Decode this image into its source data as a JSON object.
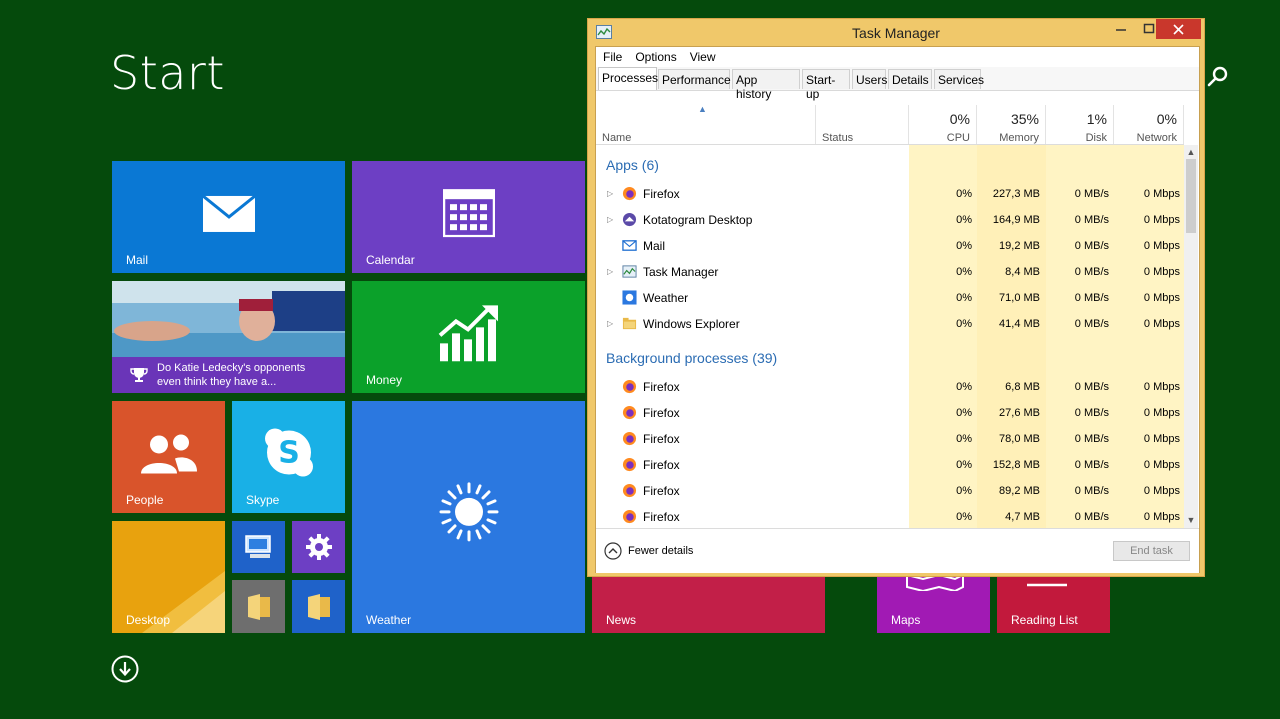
{
  "start": {
    "title": "Start"
  },
  "tiles": {
    "mail": "Mail",
    "calendar": "Calendar",
    "news_headline": "Do Katie Ledecky's opponents even think they have a...",
    "money": "Money",
    "people": "People",
    "skype": "Skype",
    "weather": "Weather",
    "desktop": "Desktop",
    "news": "News",
    "maps": "Maps",
    "reading_list": "Reading List"
  },
  "colors": {
    "background": "#054a0c",
    "mail": "#0a78d4",
    "calendar": "#6d3fc4",
    "money": "#0ba12a",
    "people": "#d9542b",
    "skype": "#19b0e6",
    "weather": "#2b78e0",
    "desktop": "#e8a20e",
    "news": "#c21f48",
    "maps": "#a11ab4",
    "reading_list": "#c2193c"
  },
  "task_manager": {
    "title": "Task Manager",
    "menu": [
      "File",
      "Options",
      "View"
    ],
    "tabs": [
      "Processes",
      "Performance",
      "App history",
      "Start-up",
      "Users",
      "Details",
      "Services"
    ],
    "active_tab": "Processes",
    "columns": {
      "name": "Name",
      "status": "Status",
      "cpu": {
        "pct": "0%",
        "label": "CPU"
      },
      "memory": {
        "pct": "35%",
        "label": "Memory"
      },
      "disk": {
        "pct": "1%",
        "label": "Disk"
      },
      "network": {
        "pct": "0%",
        "label": "Network"
      }
    },
    "apps_header": "Apps (6)",
    "apps": [
      {
        "name": "Firefox",
        "icon": "firefox-icon",
        "expand": true,
        "cpu": "0%",
        "memory": "227,3 MB",
        "disk": "0 MB/s",
        "network": "0 Mbps"
      },
      {
        "name": "Kotatogram Desktop",
        "icon": "kotatogram-icon",
        "expand": true,
        "cpu": "0%",
        "memory": "164,9 MB",
        "disk": "0 MB/s",
        "network": "0 Mbps"
      },
      {
        "name": "Mail",
        "icon": "mail-icon",
        "expand": false,
        "cpu": "0%",
        "memory": "19,2 MB",
        "disk": "0 MB/s",
        "network": "0 Mbps"
      },
      {
        "name": "Task Manager",
        "icon": "task-manager-icon",
        "expand": true,
        "cpu": "0%",
        "memory": "8,4 MB",
        "disk": "0 MB/s",
        "network": "0 Mbps"
      },
      {
        "name": "Weather",
        "icon": "weather-icon",
        "expand": false,
        "cpu": "0%",
        "memory": "71,0 MB",
        "disk": "0 MB/s",
        "network": "0 Mbps"
      },
      {
        "name": "Windows Explorer",
        "icon": "folder-icon",
        "expand": true,
        "cpu": "0%",
        "memory": "41,4 MB",
        "disk": "0 MB/s",
        "network": "0 Mbps"
      }
    ],
    "bg_header": "Background processes (39)",
    "background": [
      {
        "name": "Firefox",
        "cpu": "0%",
        "memory": "6,8 MB",
        "disk": "0 MB/s",
        "network": "0 Mbps"
      },
      {
        "name": "Firefox",
        "cpu": "0%",
        "memory": "27,6 MB",
        "disk": "0 MB/s",
        "network": "0 Mbps"
      },
      {
        "name": "Firefox",
        "cpu": "0%",
        "memory": "78,0 MB",
        "disk": "0 MB/s",
        "network": "0 Mbps"
      },
      {
        "name": "Firefox",
        "cpu": "0%",
        "memory": "152,8 MB",
        "disk": "0 MB/s",
        "network": "0 Mbps"
      },
      {
        "name": "Firefox",
        "cpu": "0%",
        "memory": "89,2 MB",
        "disk": "0 MB/s",
        "network": "0 Mbps"
      },
      {
        "name": "Firefox",
        "cpu": "0%",
        "memory": "4,7 MB",
        "disk": "0 MB/s",
        "network": "0 Mbps"
      }
    ],
    "fewer_details": "Fewer details",
    "end_task": "End task"
  }
}
